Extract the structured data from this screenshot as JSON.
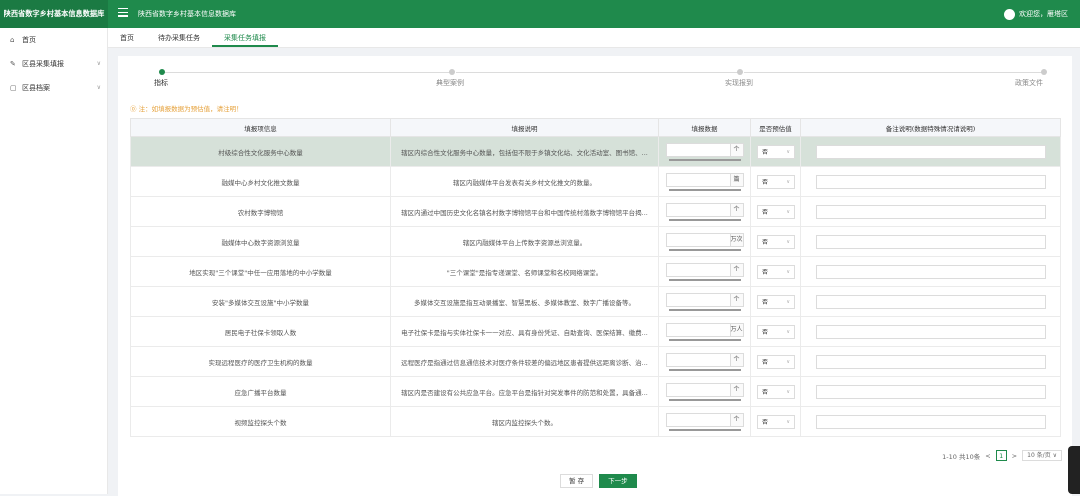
{
  "app": {
    "brand": "陕西省数字乡村基本信息数据库",
    "title": "陕西省数字乡村基本信息数据库",
    "welcome": "欢迎您，雁塔区"
  },
  "sidebar": {
    "items": [
      {
        "label": "首页",
        "icon": "home-icon"
      },
      {
        "label": "区县采集填报",
        "icon": "edit-icon",
        "has_caret": true
      },
      {
        "label": "区县档案",
        "icon": "folder-icon",
        "has_caret": true
      }
    ]
  },
  "tabs": [
    {
      "label": "首页"
    },
    {
      "label": "待办采集任务"
    },
    {
      "label": "采集任务填报",
      "active": true
    }
  ],
  "steps": [
    {
      "label": "指标",
      "active": true
    },
    {
      "label": "典型案例"
    },
    {
      "label": "实现报到"
    },
    {
      "label": "政策文件"
    }
  ],
  "notice": "⓪ 注：如填报数据为预估值，请注明！",
  "table": {
    "headers": [
      "填报项信息",
      "填报说明",
      "填报数据",
      "是否预估值",
      "备注说明(数据特殊情况请说明)"
    ],
    "rows": [
      {
        "item": "村级综合性文化服务中心数量",
        "desc": "辖区内综合性文化服务中心数量，包括但不限于乡镇文化站、文化活动室、图书馆、...",
        "unit": "个",
        "estimate": "否"
      },
      {
        "item": "融媒中心乡村文化推文数量",
        "desc": "辖区内融媒体平台发表有关乡村文化推文的数量。",
        "unit": "篇",
        "estimate": "否"
      },
      {
        "item": "农村数字博物馆",
        "desc": "辖区内通过中国历史文化名镇名村数字博物馆平台和中国传统村落数字博物馆平台揭...",
        "unit": "个",
        "estimate": "否"
      },
      {
        "item": "融媒体中心数字资源浏览量",
        "desc": "辖区内融媒体平台上传数字资源总浏览量。",
        "unit": "万次",
        "estimate": "否"
      },
      {
        "item": "地区实现\"三个课堂\"中任一应用落地的中小学数量",
        "desc": "\"三个课堂\"是指专递课堂、名师课堂和名校网络课堂。",
        "unit": "个",
        "estimate": "否"
      },
      {
        "item": "安装\"多媒体交互设施\"中小学数量",
        "desc": "多媒体交互设施是指互动录播室、智慧黑板、多媒体教室、数字广播设备等。",
        "unit": "个",
        "estimate": "否"
      },
      {
        "item": "居民电子社保卡领取人数",
        "desc": "电子社保卡是指与实体社保卡一一对应、具有身份凭证、自助查询、医保结算、缴费...",
        "unit": "万人",
        "estimate": "否"
      },
      {
        "item": "实现远程医疗的医疗卫生机构的数量",
        "desc": "远程医疗是指通过信息通信技术对医疗条件较差的偏远地区患者提供远距离诊断、治...",
        "unit": "个",
        "estimate": "否"
      },
      {
        "item": "应急广播平台数量",
        "desc": "辖区内是否建设有公共应急平台。应急平台是指针对突发事件的防范和处置，具备通...",
        "unit": "个",
        "estimate": "否"
      },
      {
        "item": "视频监控探头个数",
        "desc": "辖区内监控探头个数。",
        "unit": "个",
        "estimate": "否"
      }
    ]
  },
  "pager": {
    "summary": "1-10 共10条",
    "prev": "<",
    "current": "1",
    "next": ">",
    "page_size": "10 条/页 ∨"
  },
  "buttons": {
    "save": "暂 存",
    "next": "下一步"
  },
  "colors": {
    "primary": "#1f8a4c",
    "highlight_row": "#d6e1d9",
    "notice": "#e6a23c"
  }
}
